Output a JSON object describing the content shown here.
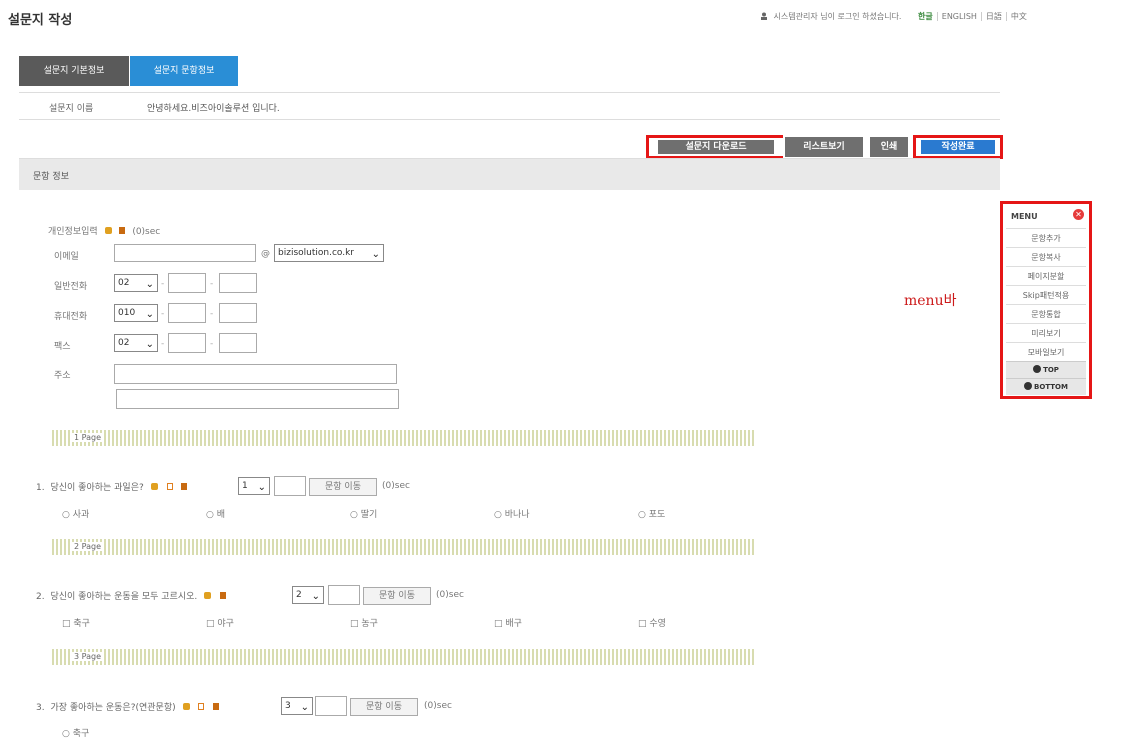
{
  "header": {
    "title": "설문지 작성",
    "login_msg": "시스템관리자 님이 로그인 하셨습니다.",
    "langs": [
      "한글",
      "ENGLISH",
      "日語",
      "中文"
    ]
  },
  "tabs": {
    "basic": "설문지 기본정보",
    "items": "설문지 문항정보"
  },
  "survey": {
    "name_label": "설문지 이름",
    "name_value": "안녕하세요.비즈아이솔루션 입니다."
  },
  "toolbar": {
    "download": "설문지 다운로드",
    "list": "리스트보기",
    "print": "인쇄",
    "done": "작성완료"
  },
  "section": {
    "title": "문항 정보"
  },
  "personal": {
    "title": "개인정보입력",
    "sec": "(0)sec",
    "email_label": "이메일",
    "email_domain": "bizisolution.co.kr",
    "phone_label": "일반전화",
    "phone_prefix": "02",
    "mobile_label": "휴대전화",
    "mobile_prefix": "010",
    "fax_label": "팩스",
    "fax_prefix": "02",
    "address_label": "주소",
    "at": "@",
    "dash": "-"
  },
  "pages": [
    "1 Page",
    "2 Page",
    "3 Page"
  ],
  "questions": [
    {
      "no": "1.",
      "text": "당신이 좋아하는 과일은?",
      "order": "1",
      "move": "문항 이동",
      "sec": "(0)sec",
      "options": [
        "사과",
        "배",
        "딸기",
        "바나나",
        "포도"
      ]
    },
    {
      "no": "2.",
      "text": "당신이 좋아하는 운동을 모두 고르시오.",
      "order": "2",
      "move": "문항 이동",
      "sec": "(0)sec",
      "options": [
        "축구",
        "야구",
        "농구",
        "배구",
        "수영"
      ]
    },
    {
      "no": "3.",
      "text": "가장 좋아하는 운동은?(연관문항)",
      "order": "3",
      "move": "문항 이동",
      "sec": "(0)sec",
      "options": [
        "축구"
      ]
    }
  ],
  "menu": {
    "title": "MENU",
    "items": [
      "문항추가",
      "문항복사",
      "페이지분할",
      "Skip패턴적용",
      "문항통합",
      "미리보기",
      "모바일보기"
    ],
    "top": "TOP",
    "bottom": "BOTTOM"
  },
  "annotation": "menu바"
}
